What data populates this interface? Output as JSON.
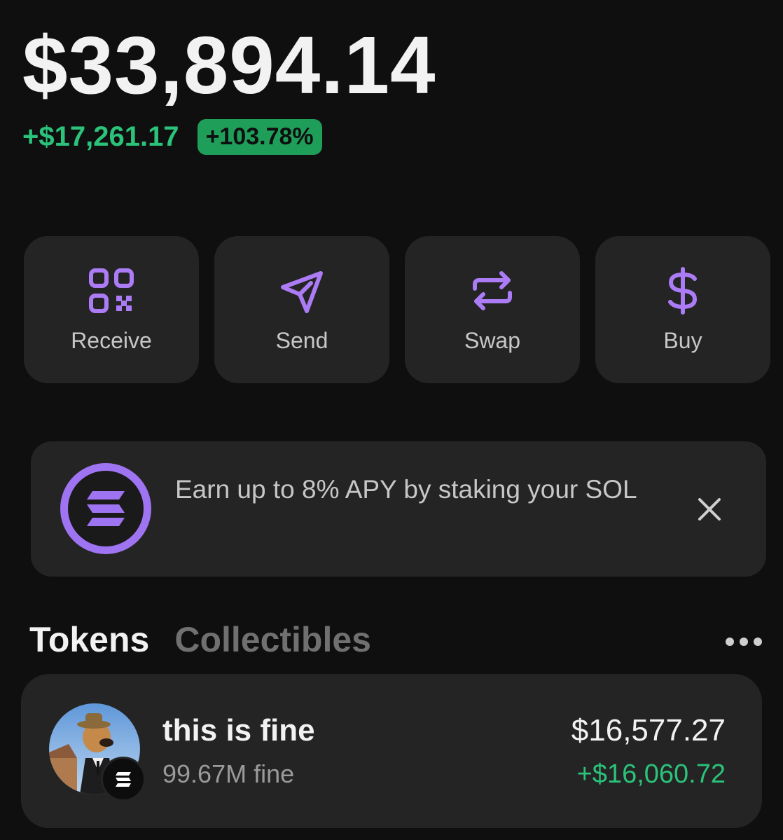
{
  "portfolio": {
    "balance": "$33,894.14",
    "change_amount": "+$17,261.17",
    "change_percent": "+103.78%"
  },
  "actions": [
    {
      "label": "Receive",
      "icon": "qr-code-icon"
    },
    {
      "label": "Send",
      "icon": "send-icon"
    },
    {
      "label": "Swap",
      "icon": "swap-icon"
    },
    {
      "label": "Buy",
      "icon": "dollar-icon"
    }
  ],
  "promo": {
    "text": "Earn up to 8% APY by staking your SOL",
    "icon": "solana-logo-icon",
    "close_icon": "close-icon"
  },
  "tabs": {
    "tokens": "Tokens",
    "collectibles": "Collectibles",
    "active": "Tokens"
  },
  "tokens": [
    {
      "name": "this is fine",
      "balance": "99.67M fine",
      "value": "$16,577.27",
      "change": "+$16,060.72"
    }
  ],
  "colors": {
    "background": "#0f0f0f",
    "card": "#242424",
    "accent_purple": "#ab7cf5",
    "positive_green": "#2bc27a",
    "badge_green": "#1f9e5a"
  }
}
